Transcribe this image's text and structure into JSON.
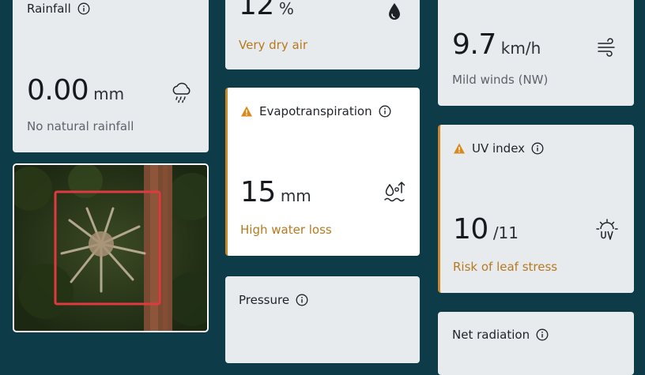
{
  "rainfall": {
    "title": "Rainfall",
    "value": "0.00",
    "unit": "mm",
    "caption": "No natural rainfall",
    "icon": "rain-cloud-icon"
  },
  "humidity": {
    "value": "12",
    "unit": "%",
    "caption": "Very dry air",
    "icon": "droplet-icon"
  },
  "wind": {
    "value": "9.7",
    "unit": "km/h",
    "caption": "Mild winds (NW)",
    "icon": "wind-icon"
  },
  "evapotranspiration": {
    "title": "Evapotranspiration",
    "value": "15",
    "unit": "mm",
    "caption": "High water loss",
    "icon": "evaporation-icon",
    "status": "warning"
  },
  "uv": {
    "title": "UV index",
    "value": "10",
    "unit": "/11",
    "caption": "Risk of leaf stress",
    "icon": "sun-uv-icon",
    "status": "warning"
  },
  "pressure": {
    "title": "Pressure"
  },
  "net_radiation": {
    "title": "Net radiation"
  },
  "colors": {
    "background": "#0d3b47",
    "card": "#e8ebee",
    "warning": "#c9882a",
    "highlight_box": "#e0393e"
  }
}
